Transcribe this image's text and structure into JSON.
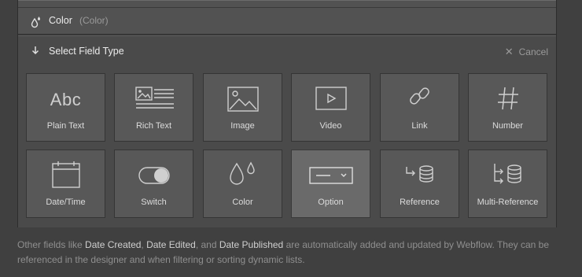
{
  "top_field": {
    "name": "Color",
    "type": "(Color)",
    "icon": "color-drop-icon"
  },
  "select": {
    "title": "Select Field Type",
    "cancel_label": "Cancel"
  },
  "field_types": [
    {
      "label": "Plain Text",
      "icon": "plain-text-icon",
      "glyph": "Abc"
    },
    {
      "label": "Rich Text",
      "icon": "rich-text-icon"
    },
    {
      "label": "Image",
      "icon": "image-icon"
    },
    {
      "label": "Video",
      "icon": "video-icon"
    },
    {
      "label": "Link",
      "icon": "link-icon"
    },
    {
      "label": "Number",
      "icon": "number-icon"
    },
    {
      "label": "Date/Time",
      "icon": "calendar-icon"
    },
    {
      "label": "Switch",
      "icon": "switch-icon"
    },
    {
      "label": "Color",
      "icon": "color-icon"
    },
    {
      "label": "Option",
      "icon": "option-icon",
      "selected": true
    },
    {
      "label": "Reference",
      "icon": "reference-icon"
    },
    {
      "label": "Multi-Reference",
      "icon": "multi-reference-icon"
    }
  ],
  "footer": {
    "prefix": "Other fields like ",
    "f1": "Date Created",
    "sep1": ", ",
    "f2": "Date Edited",
    "sep2": ", and ",
    "f3": "Date Published",
    "suffix": " are automatically added and updated by Webflow. They can be referenced in the designer and when filtering or sorting dynamic lists."
  },
  "colors": {
    "background": "#404040",
    "tile": "#585858",
    "tile_selected": "#6a6a6a"
  }
}
